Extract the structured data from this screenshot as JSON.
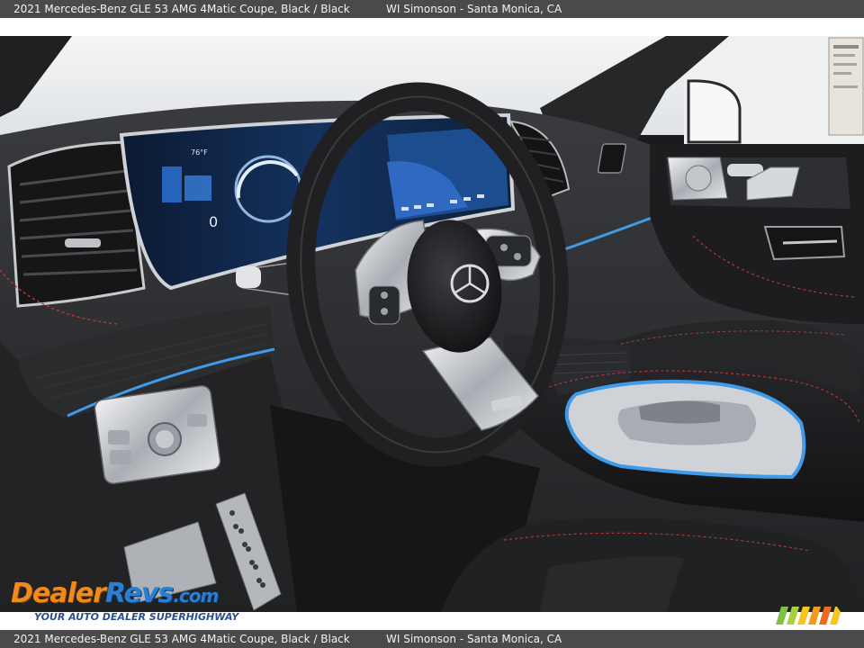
{
  "caption": {
    "title": "2021 Mercedes-Benz GLE 53 AMG 4Matic Coupe,  Black / Black",
    "dealer": "WI Simonson - Santa Monica, CA"
  },
  "photo": {
    "subject": "interior-dashboard",
    "accent_colors": {
      "ambient_light": "#3f9be8",
      "stitching": "#b0353c",
      "upholstery": "#232325",
      "trim": "#c9ccd1"
    }
  },
  "watermark": {
    "logo_dealer": "Dealer",
    "logo_revs": "Revs",
    "logo_com": ".com",
    "tagline": "YOUR AUTO DEALER SUPERHIGHWAY",
    "brand_colors": {
      "orange": "#f08a1c",
      "blue": "#2b7fd1",
      "navy": "#2a4f8a"
    }
  },
  "cluster": {
    "speed": "0",
    "temp": "76°F"
  }
}
